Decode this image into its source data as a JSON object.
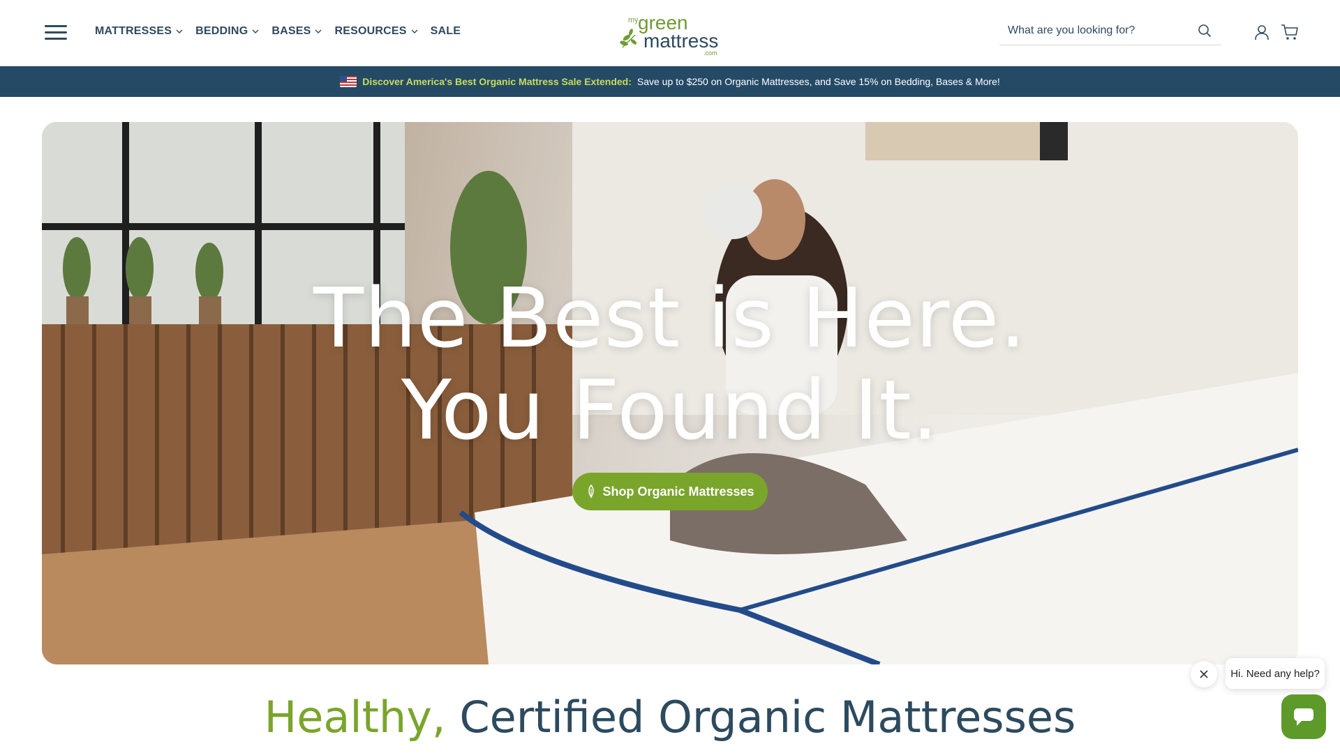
{
  "header": {
    "nav": [
      {
        "label": "MATTRESSES",
        "has_dropdown": true
      },
      {
        "label": "BEDDING",
        "has_dropdown": true
      },
      {
        "label": "BASES",
        "has_dropdown": true
      },
      {
        "label": "RESOURCES",
        "has_dropdown": true
      },
      {
        "label": "SALE",
        "has_dropdown": false
      }
    ],
    "logo": {
      "prefix": "my",
      "word1": "green",
      "word2": "mattress",
      "suffix": ".com"
    },
    "search": {
      "placeholder": "What are you looking for?"
    },
    "icons": [
      "menu-icon",
      "search-icon",
      "user-icon",
      "cart-icon"
    ]
  },
  "promo": {
    "highlight": "Discover America's Best Organic Mattress Sale Extended:",
    "text": "Save up to $250 on Organic Mattresses, and Save 15% on Bedding, Bases & More!"
  },
  "hero": {
    "line1": "The Best is Here.",
    "line2": "You Found It.",
    "cta": "Shop Organic Mattresses"
  },
  "section": {
    "accent": "Healthy,",
    "title": "Certified Organic Mattresses"
  },
  "chat": {
    "message": "Hi. Need any help?"
  },
  "colors": {
    "navy": "#2d4a5e",
    "promo_bg": "#244a66",
    "promo_highlight": "#c8dd5a",
    "green": "#7aa52b",
    "chat_green": "#5d9a2a"
  }
}
